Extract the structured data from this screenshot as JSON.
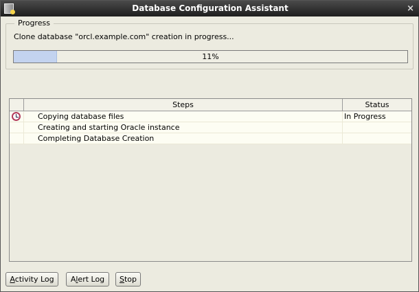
{
  "window": {
    "title": "Database Configuration Assistant",
    "close": "×"
  },
  "progress": {
    "legend": "Progress",
    "message": "Clone database \"orcl.example.com\" creation in progress...",
    "percent": 11,
    "percent_label": "11%"
  },
  "table": {
    "headers": {
      "steps": "Steps",
      "status": "Status"
    },
    "rows": [
      {
        "step": "Copying database files",
        "status": "In Progress",
        "icon": "clock-icon"
      },
      {
        "step": "Creating and starting Oracle instance",
        "status": ""
      },
      {
        "step": "Completing Database Creation",
        "status": ""
      }
    ]
  },
  "buttons": {
    "activity_log": {
      "label": "Activity Log",
      "pre": "",
      "mn": "A",
      "post": "ctivity Log"
    },
    "alert_log": {
      "label": "Alert Log",
      "pre": "A",
      "mn": "l",
      "post": "ert Log"
    },
    "stop": {
      "label": "Stop",
      "pre": "",
      "mn": "S",
      "post": "top"
    }
  }
}
